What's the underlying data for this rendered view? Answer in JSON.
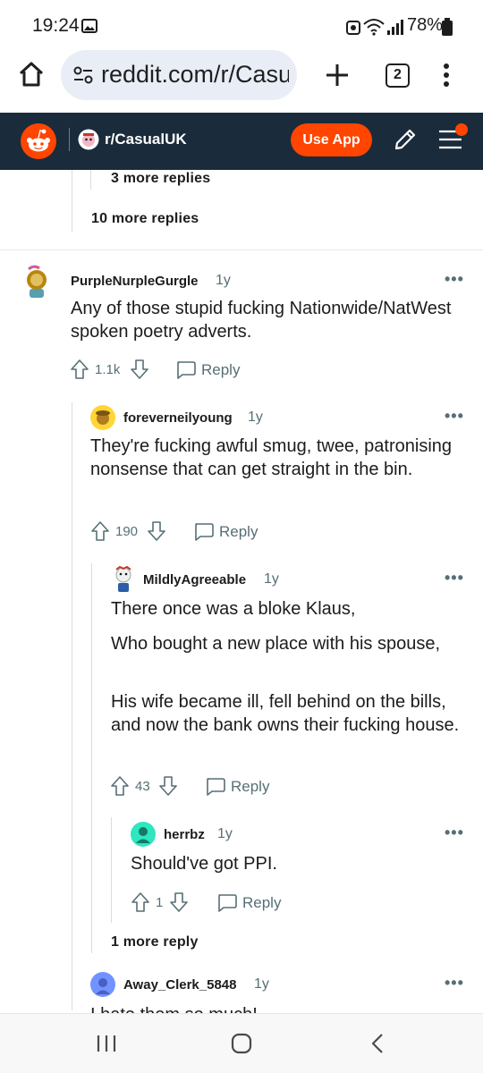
{
  "status_bar": {
    "time": "19:24",
    "battery": "78%"
  },
  "browser": {
    "url": "reddit.com/r/Casu",
    "tab_count": "2"
  },
  "header": {
    "subreddit": "r/CasualUK",
    "use_app_label": "Use App"
  },
  "thread": {
    "more_replies_label": "3 more replies",
    "more_replies_10_label": "10 more replies",
    "comments": [
      {
        "username": "PurpleNurpleGurgle",
        "age": "1y",
        "body": "Any of those stupid fucking Nationwide/NatWest spoken poetry adverts.",
        "votes": "1.1k",
        "reply_label": "Reply"
      },
      {
        "username": "foreverneilyoung",
        "age": "1y",
        "body": "They're fucking awful smug, twee, patronising nonsense that can get straight in the bin.",
        "votes": "190",
        "reply_label": "Reply"
      },
      {
        "username": "MildlyAgreeable",
        "age": "1y",
        "paragraphs": [
          "There once was a bloke Klaus,",
          "Who bought a new place with his spouse,",
          "His wife became ill, fell behind on the bills, and now the bank owns their fucking house."
        ],
        "votes": "43",
        "reply_label": "Reply"
      },
      {
        "username": "herrbz",
        "age": "1y",
        "body": "Should've got PPI.",
        "votes": "1",
        "reply_label": "Reply"
      },
      {
        "username": "Away_Clerk_5848",
        "age": "1y",
        "body": "I hate them so much!"
      }
    ],
    "more_reply_label": "1 more reply"
  },
  "colors": {
    "reddit_orange": "#ff4500",
    "header_bg": "#1a2b3c",
    "url_pill": "#e9eef6"
  },
  "icons": [
    "image-icon",
    "home-icon",
    "site-settings-icon",
    "plus-icon",
    "more-vert-icon",
    "reddit-logo-icon",
    "subreddit-avatar-icon",
    "pencil-icon",
    "menu-icon",
    "upvote-icon",
    "downvote-icon",
    "comment-icon"
  ]
}
